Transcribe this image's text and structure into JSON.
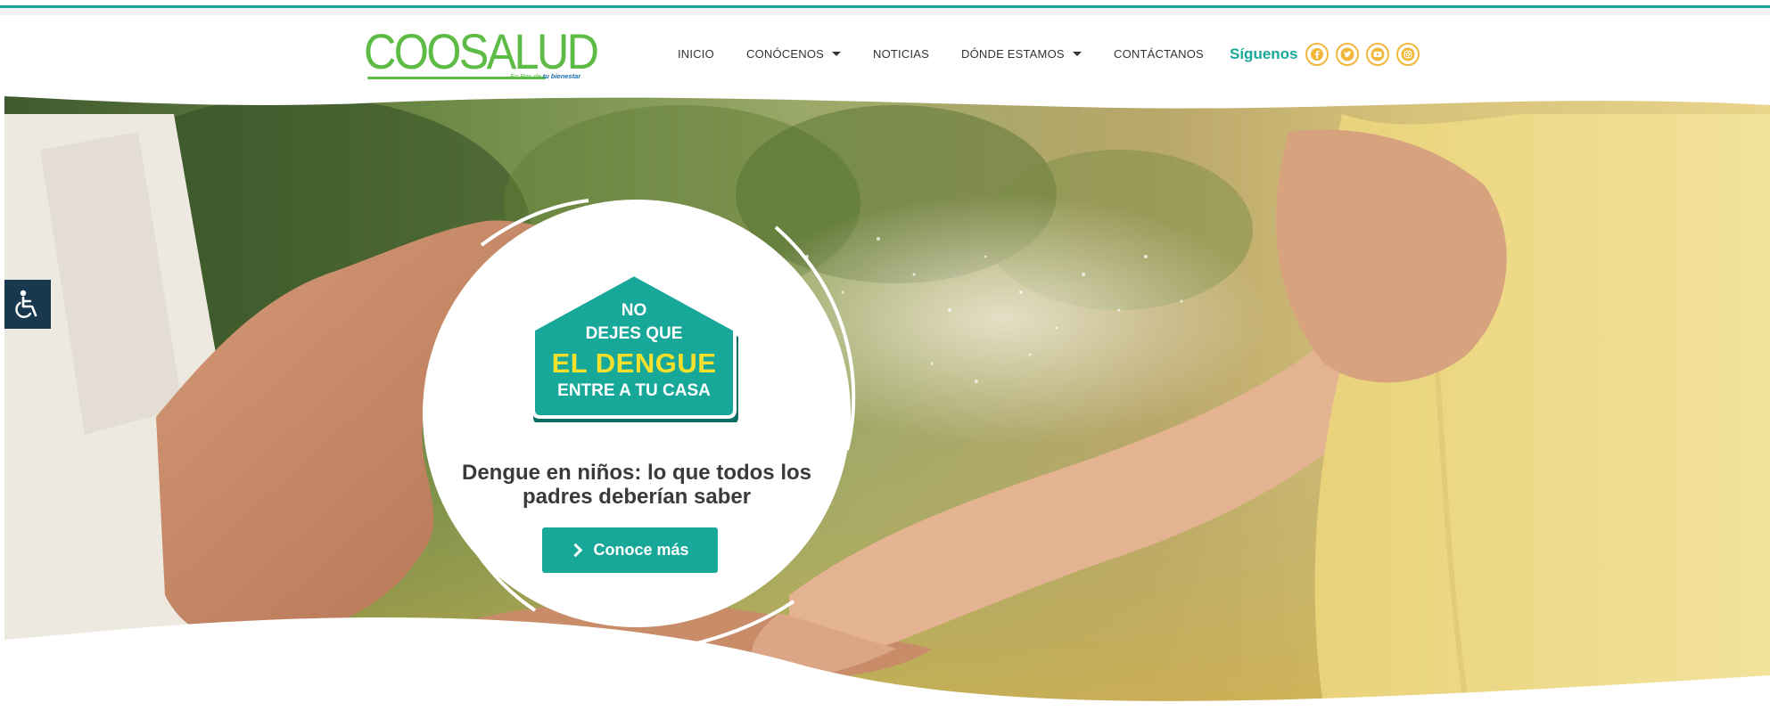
{
  "brand": {
    "name": "COOSALUD",
    "tagline_prefix": "En Pos de",
    "tagline_bold": "tu bienestar",
    "color_green": "#5dbb46",
    "color_teal": "#17a89a"
  },
  "nav": {
    "items": [
      {
        "label": "INICIO",
        "has_dropdown": false
      },
      {
        "label": "CONÓCENOS",
        "has_dropdown": true
      },
      {
        "label": "NOTICIAS",
        "has_dropdown": false
      },
      {
        "label": "DÓNDE ESTAMOS",
        "has_dropdown": true
      },
      {
        "label": "CONTÁCTANOS",
        "has_dropdown": false
      }
    ],
    "follow_label": "Síguenos",
    "social": [
      {
        "icon": "facebook-icon"
      },
      {
        "icon": "twitter-icon"
      },
      {
        "icon": "youtube-icon"
      },
      {
        "icon": "instagram-icon"
      }
    ],
    "social_color": "#f0b73b"
  },
  "hero": {
    "badge": {
      "line1": "NO",
      "line2": "DEJES QUE",
      "line3": "EL DENGUE",
      "line4": "ENTRE A TU CASA",
      "color": "#17a89a",
      "highlight": "#f5e12b"
    },
    "headline": "Dengue en niños: lo que todos los padres deberían saber",
    "cta_label": "Conoce más"
  },
  "accessibility": {
    "icon": "wheelchair-icon",
    "color": "#18384f"
  }
}
